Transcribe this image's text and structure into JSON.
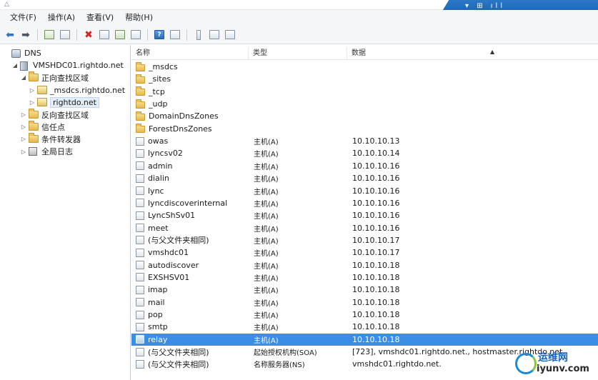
{
  "menu": [
    "文件(F)",
    "操作(A)",
    "查看(V)",
    "帮助(H)"
  ],
  "taskbar": {
    "glyphs": "▾ ⊞ ıll"
  },
  "tree": [
    {
      "label": "DNS",
      "level": 0,
      "icon": "dns-icon",
      "expander": ""
    },
    {
      "label": "VMSHDC01.rightdo.net",
      "level": 1,
      "icon": "server-icon",
      "expander": "◢"
    },
    {
      "label": "正向查找区域",
      "level": 2,
      "icon": "folder-icon",
      "expander": "◢"
    },
    {
      "label": "_msdcs.rightdo.net",
      "level": 3,
      "icon": "zone-icon",
      "expander": "▷"
    },
    {
      "label": "rightdo.net",
      "level": 3,
      "icon": "zone-icon",
      "expander": "▷",
      "selected": true
    },
    {
      "label": "反向查找区域",
      "level": 2,
      "icon": "folder-icon",
      "expander": "▷"
    },
    {
      "label": "信任点",
      "level": 2,
      "icon": "folder-icon",
      "expander": "▷"
    },
    {
      "label": "条件转发器",
      "level": 2,
      "icon": "folder-icon",
      "expander": "▷"
    },
    {
      "label": "全局日志",
      "level": 2,
      "icon": "log-icon",
      "expander": "▷"
    }
  ],
  "columns": {
    "name": "名称",
    "type": "类型",
    "data": "数据"
  },
  "records": [
    {
      "name": "_msdcs",
      "type": "",
      "data": "",
      "icon": "folder"
    },
    {
      "name": "_sites",
      "type": "",
      "data": "",
      "icon": "folder"
    },
    {
      "name": "_tcp",
      "type": "",
      "data": "",
      "icon": "folder"
    },
    {
      "name": "_udp",
      "type": "",
      "data": "",
      "icon": "folder"
    },
    {
      "name": "DomainDnsZones",
      "type": "",
      "data": "",
      "icon": "folder"
    },
    {
      "name": "ForestDnsZones",
      "type": "",
      "data": "",
      "icon": "folder"
    },
    {
      "name": "owas",
      "type": "主机(A)",
      "data": "10.10.10.13",
      "icon": "record"
    },
    {
      "name": "lyncsv02",
      "type": "主机(A)",
      "data": "10.10.10.14",
      "icon": "record"
    },
    {
      "name": "admin",
      "type": "主机(A)",
      "data": "10.10.10.16",
      "icon": "record"
    },
    {
      "name": "dialin",
      "type": "主机(A)",
      "data": "10.10.10.16",
      "icon": "record"
    },
    {
      "name": "lync",
      "type": "主机(A)",
      "data": "10.10.10.16",
      "icon": "record"
    },
    {
      "name": "lyncdiscoverinternal",
      "type": "主机(A)",
      "data": "10.10.10.16",
      "icon": "record"
    },
    {
      "name": "LyncShSv01",
      "type": "主机(A)",
      "data": "10.10.10.16",
      "icon": "record"
    },
    {
      "name": "meet",
      "type": "主机(A)",
      "data": "10.10.10.16",
      "icon": "record"
    },
    {
      "name": "(与父文件夹相同)",
      "type": "主机(A)",
      "data": "10.10.10.17",
      "icon": "record"
    },
    {
      "name": "vmshdc01",
      "type": "主机(A)",
      "data": "10.10.10.17",
      "icon": "record"
    },
    {
      "name": "autodiscover",
      "type": "主机(A)",
      "data": "10.10.10.18",
      "icon": "record"
    },
    {
      "name": "EXSHSV01",
      "type": "主机(A)",
      "data": "10.10.10.18",
      "icon": "record"
    },
    {
      "name": "imap",
      "type": "主机(A)",
      "data": "10.10.10.18",
      "icon": "record"
    },
    {
      "name": "mail",
      "type": "主机(A)",
      "data": "10.10.10.18",
      "icon": "record"
    },
    {
      "name": "pop",
      "type": "主机(A)",
      "data": "10.10.10.18",
      "icon": "record"
    },
    {
      "name": "smtp",
      "type": "主机(A)",
      "data": "10.10.10.18",
      "icon": "record"
    },
    {
      "name": "relay",
      "type": "主机(A)",
      "data": "10.10.10.18",
      "icon": "record",
      "selected": true
    },
    {
      "name": "(与父文件夹相同)",
      "type": "起始授权机构(SOA)",
      "data": "[723], vmshdc01.rightdo.net., hostmaster.rightdo.net.",
      "icon": "record"
    },
    {
      "name": "(与父文件夹相同)",
      "type": "名称服务器(NS)",
      "data": "vmshdc01.rightdo.net.",
      "icon": "record"
    }
  ],
  "watermark": {
    "top": "运维网",
    "bottom": "iyunv.com"
  },
  "colors": {
    "selection": "#3a8ee6",
    "accent": "#2e74c4"
  }
}
